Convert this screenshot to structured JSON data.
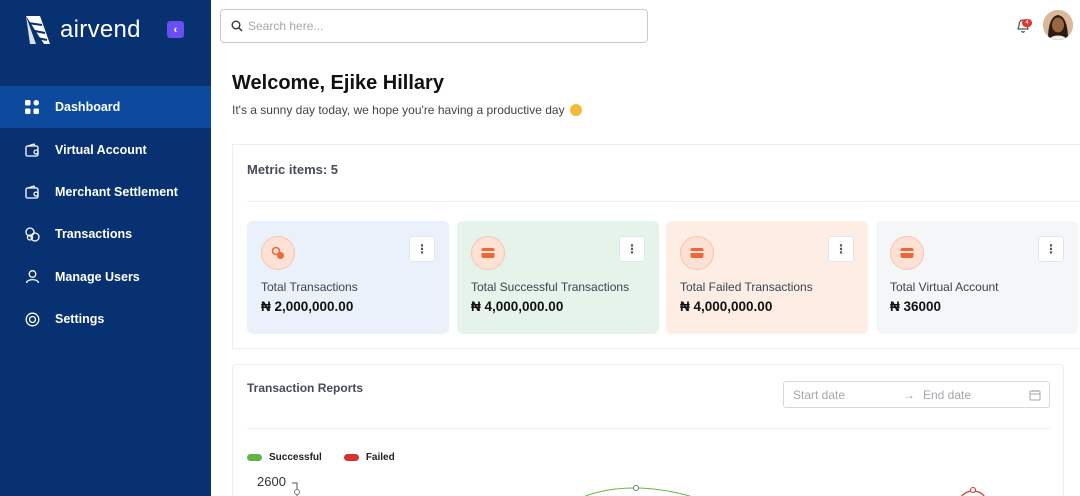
{
  "brand": {
    "name": "airvend",
    "collapse_icon": "chevron-left-icon"
  },
  "sidebar": {
    "items": [
      {
        "label": "Dashboard",
        "icon": "grid-icon",
        "active": true
      },
      {
        "label": "Virtual Account",
        "icon": "wallet-icon",
        "active": false
      },
      {
        "label": "Merchant Settlement",
        "icon": "wallet-icon",
        "active": false
      },
      {
        "label": "Transactions",
        "icon": "transactions-icon",
        "active": false
      },
      {
        "label": "Manage Users",
        "icon": "user-icon",
        "active": false
      },
      {
        "label": "Settings",
        "icon": "gear-icon",
        "active": false
      }
    ]
  },
  "topbar": {
    "search_placeholder": "Search here...",
    "notification_count": "4"
  },
  "welcome": {
    "title": "Welcome, Ejike Hillary",
    "subtitle": "It's a sunny day today, we hope you're having a productive day"
  },
  "metrics": {
    "title": "Metric items: 5",
    "cards": [
      {
        "label": "Total Transactions",
        "value": "₦ 2,000,000.00",
        "bg": "#eaf1fb"
      },
      {
        "label": "Total Successful Transactions",
        "value": "₦ 4,000,000.00",
        "bg": "#e6f3ea"
      },
      {
        "label": "Total Failed Transactions",
        "value": "₦ 4,000,000.00",
        "bg": "#fdede4"
      },
      {
        "label": "Total Virtual Account",
        "value": "₦ 36000",
        "bg": "#f4f6f8"
      }
    ]
  },
  "reports": {
    "title": "Transaction Reports",
    "start_placeholder": "Start date",
    "arrow": "→",
    "end_placeholder": "End date",
    "legend": [
      {
        "label": "Successful",
        "color": "#5fb544"
      },
      {
        "label": "Failed",
        "color": "#d6322e"
      }
    ],
    "y_tick_top": "2600"
  },
  "colors": {
    "sidebar_bg": "#073170",
    "sidebar_active": "#0d4a9e",
    "accent_icon": "#e8693a"
  }
}
